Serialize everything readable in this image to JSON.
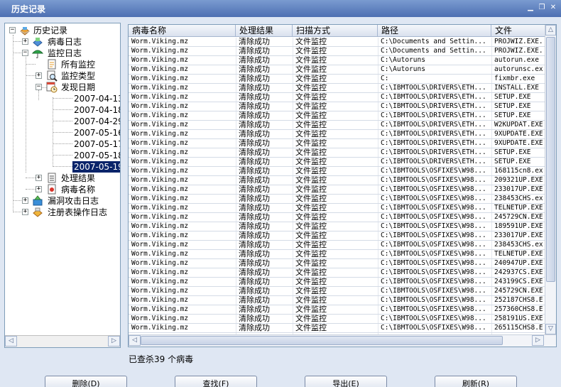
{
  "window": {
    "title": "历史记录"
  },
  "tree": {
    "root": "历史记录",
    "nodes": {
      "virus_log": "病毒日志",
      "monitor_log": "监控日志",
      "all_monitor": "所有监控",
      "monitor_type": "监控类型",
      "discovery_date": "发现日期",
      "dates": [
        "2007-04-13",
        "2007-04-18",
        "2007-04-29",
        "2007-05-16",
        "2007-05-17",
        "2007-05-18",
        "2007-05-19"
      ],
      "process_result": "处理结果",
      "virus_name": "病毒名称",
      "vuln_log": "漏洞攻击日志",
      "registry_log": "注册表操作日志"
    },
    "selected": "2007-05-19"
  },
  "grid": {
    "columns": [
      "病毒名称",
      "处理结果",
      "扫描方式",
      "路径",
      "文件"
    ],
    "rows": [
      [
        "Worm.Viking.mz",
        "清除成功",
        "文件监控",
        "C:\\Documents and Settin...",
        "PROJWIZ.EXE."
      ],
      [
        "Worm.Viking.mz",
        "清除成功",
        "文件监控",
        "C:\\Documents and Settin...",
        "PROJWIZ.EXE."
      ],
      [
        "Worm.Viking.mz",
        "清除成功",
        "文件监控",
        "C:\\Autoruns",
        "autorun.exe"
      ],
      [
        "Worm.Viking.mz",
        "清除成功",
        "文件监控",
        "C:\\Autoruns",
        "autorunsc.ex"
      ],
      [
        "Worm.Viking.mz",
        "清除成功",
        "文件监控",
        "C:",
        "fixmbr.exe"
      ],
      [
        "Worm.Viking.mz",
        "清除成功",
        "文件监控",
        "C:\\IBMTOOLS\\DRIVERS\\ETH...",
        "INSTALL.EXE"
      ],
      [
        "Worm.Viking.mz",
        "清除成功",
        "文件监控",
        "C:\\IBMTOOLS\\DRIVERS\\ETH...",
        "SETUP.EXE"
      ],
      [
        "Worm.Viking.mz",
        "清除成功",
        "文件监控",
        "C:\\IBMTOOLS\\DRIVERS\\ETH...",
        "SETUP.EXE"
      ],
      [
        "Worm.Viking.mz",
        "清除成功",
        "文件监控",
        "C:\\IBMTOOLS\\DRIVERS\\ETH...",
        "SETUP.EXE"
      ],
      [
        "Worm.Viking.mz",
        "清除成功",
        "文件监控",
        "C:\\IBMTOOLS\\DRIVERS\\ETH...",
        "W2KUPDAT.EXE"
      ],
      [
        "Worm.Viking.mz",
        "清除成功",
        "文件监控",
        "C:\\IBMTOOLS\\DRIVERS\\ETH...",
        "9XUPDATE.EXE"
      ],
      [
        "Worm.Viking.mz",
        "清除成功",
        "文件监控",
        "C:\\IBMTOOLS\\DRIVERS\\ETH...",
        "9XUPDATE.EXE"
      ],
      [
        "Worm.Viking.mz",
        "清除成功",
        "文件监控",
        "C:\\IBMTOOLS\\DRIVERS\\ETH...",
        "SETUP.EXE"
      ],
      [
        "Worm.Viking.mz",
        "清除成功",
        "文件监控",
        "C:\\IBMTOOLS\\DRIVERS\\ETH...",
        "SETUP.EXE"
      ],
      [
        "Worm.Viking.mz",
        "清除成功",
        "文件监控",
        "C:\\IBMTOOLS\\OSFIXES\\W98...",
        "168115cn8.ex"
      ],
      [
        "Worm.Viking.mz",
        "清除成功",
        "文件监控",
        "C:\\IBMTOOLS\\OSFIXES\\W98...",
        "209321UP.EXE"
      ],
      [
        "Worm.Viking.mz",
        "清除成功",
        "文件监控",
        "C:\\IBMTOOLS\\OSFIXES\\W98...",
        "233017UP.EXE"
      ],
      [
        "Worm.Viking.mz",
        "清除成功",
        "文件监控",
        "C:\\IBMTOOLS\\OSFIXES\\W98...",
        "238453CHS.ex"
      ],
      [
        "Worm.Viking.mz",
        "清除成功",
        "文件监控",
        "C:\\IBMTOOLS\\OSFIXES\\W98...",
        "TELNETUP.EXE"
      ],
      [
        "Worm.Viking.mz",
        "清除成功",
        "文件监控",
        "C:\\IBMTOOLS\\OSFIXES\\W98...",
        "245729CN.EXE"
      ],
      [
        "Worm.Viking.mz",
        "清除成功",
        "文件监控",
        "C:\\IBMTOOLS\\OSFIXES\\W98...",
        "189591UP.EXE"
      ],
      [
        "Worm.Viking.mz",
        "清除成功",
        "文件监控",
        "C:\\IBMTOOLS\\OSFIXES\\W98...",
        "233017UP.EXE"
      ],
      [
        "Worm.Viking.mz",
        "清除成功",
        "文件监控",
        "C:\\IBMTOOLS\\OSFIXES\\W98...",
        "238453CHS.ex"
      ],
      [
        "Worm.Viking.mz",
        "清除成功",
        "文件监控",
        "C:\\IBMTOOLS\\OSFIXES\\W98...",
        "TELNETUP.EXE"
      ],
      [
        "Worm.Viking.mz",
        "清除成功",
        "文件监控",
        "C:\\IBMTOOLS\\OSFIXES\\W98...",
        "240947UP.EXE"
      ],
      [
        "Worm.Viking.mz",
        "清除成功",
        "文件监控",
        "C:\\IBMTOOLS\\OSFIXES\\W98...",
        "242937CS.EXE"
      ],
      [
        "Worm.Viking.mz",
        "清除成功",
        "文件监控",
        "C:\\IBMTOOLS\\OSFIXES\\W98...",
        "243199CS.EXE"
      ],
      [
        "Worm.Viking.mz",
        "清除成功",
        "文件监控",
        "C:\\IBMTOOLS\\OSFIXES\\W98...",
        "245729CN.EXE"
      ],
      [
        "Worm.Viking.mz",
        "清除成功",
        "文件监控",
        "C:\\IBMTOOLS\\OSFIXES\\W98...",
        "252187CHS8.E"
      ],
      [
        "Worm.Viking.mz",
        "清除成功",
        "文件监控",
        "C:\\IBMTOOLS\\OSFIXES\\W98...",
        "257360CHS8.E"
      ],
      [
        "Worm.Viking.mz",
        "清除成功",
        "文件监控",
        "C:\\IBMTOOLS\\OSFIXES\\W98...",
        "258191US.EXE"
      ],
      [
        "Worm.Viking.mz",
        "清除成功",
        "文件监控",
        "C:\\IBMTOOLS\\OSFIXES\\W98...",
        "265115CHS8.E"
      ]
    ]
  },
  "status": "已查杀39 个病毒",
  "buttons": {
    "delete": "删除(D)",
    "find": "查找(F)",
    "export": "导出(E)",
    "refresh": "刷新(R)"
  },
  "colors": {
    "titlebar": "#4d6fb2",
    "selection": "#0a246a",
    "background": "#dfe7f3"
  }
}
